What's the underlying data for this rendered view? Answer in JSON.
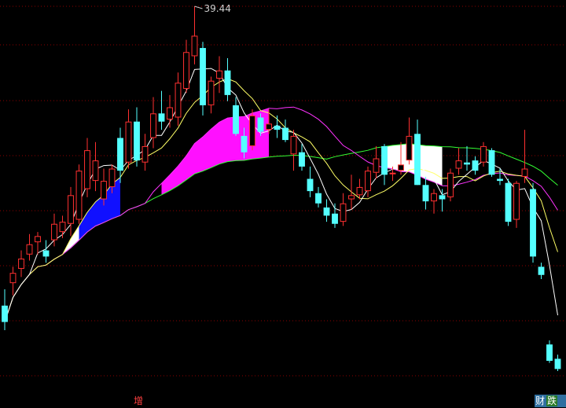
{
  "chart_data": {
    "type": "candlestick",
    "grid": true,
    "max_label": "39.44",
    "markers": [
      "增",
      "财",
      "跌"
    ],
    "colors": {
      "background": "#000000",
      "grid": "#8b0000",
      "up": "#ff3030",
      "down": "#54ffff",
      "ma_white": "#ffffff",
      "ma_yellow": "#ffff66",
      "ma_magenta": "#ff33ff",
      "ma_green": "#33ff33",
      "band_white": "#ffffff",
      "band_blue": "#1010ff",
      "band_magenta": "#ff10ff"
    },
    "candles": [
      [
        24.8,
        25.6,
        23.6,
        24.0
      ],
      [
        25.9,
        26.7,
        25.3,
        26.4
      ],
      [
        26.6,
        27.5,
        26.2,
        27.1
      ],
      [
        27.3,
        28.3,
        27.0,
        27.8
      ],
      [
        27.9,
        28.4,
        27.3,
        28.2
      ],
      [
        27.5,
        28.0,
        26.9,
        27.2
      ],
      [
        28.0,
        29.3,
        27.7,
        28.8
      ],
      [
        28.4,
        29.2,
        28.1,
        28.9
      ],
      [
        28.8,
        30.6,
        28.2,
        30.2
      ],
      [
        29.0,
        31.7,
        28.8,
        31.4
      ],
      [
        30.5,
        33.0,
        30.1,
        32.4
      ],
      [
        30.9,
        32.8,
        30.4,
        31.9
      ],
      [
        30.0,
        31.5,
        29.7,
        30.9
      ],
      [
        30.6,
        31.7,
        30.3,
        31.5
      ],
      [
        33.0,
        33.5,
        30.8,
        31.4
      ],
      [
        31.8,
        34.4,
        31.5,
        33.8
      ],
      [
        33.8,
        34.5,
        31.6,
        31.9
      ],
      [
        31.8,
        33.2,
        31.4,
        32.6
      ],
      [
        33.0,
        35.0,
        32.5,
        34.2
      ],
      [
        34.2,
        35.3,
        33.4,
        33.8
      ],
      [
        33.9,
        35.1,
        33.5,
        34.5
      ],
      [
        34.0,
        36.2,
        33.6,
        35.7
      ],
      [
        35.4,
        37.8,
        35.2,
        37.2
      ],
      [
        37.0,
        39.44,
        36.6,
        38.0
      ],
      [
        37.4,
        37.7,
        34.1,
        34.6
      ],
      [
        34.6,
        36.0,
        34.2,
        35.8
      ],
      [
        35.9,
        37.0,
        35.2,
        36.3
      ],
      [
        36.3,
        36.9,
        34.8,
        35.1
      ],
      [
        34.6,
        35.0,
        33.1,
        33.2
      ],
      [
        33.1,
        33.5,
        32.0,
        32.3
      ],
      [
        32.6,
        34.4,
        32.4,
        34.1
      ],
      [
        34.0,
        34.2,
        33.1,
        33.3
      ],
      [
        33.4,
        34.4,
        33.2,
        33.7
      ],
      [
        33.6,
        34.1,
        33.0,
        33.4
      ],
      [
        33.5,
        33.9,
        32.8,
        32.9
      ],
      [
        32.2,
        33.4,
        31.4,
        33.1
      ],
      [
        32.3,
        32.7,
        31.4,
        31.6
      ],
      [
        31.0,
        31.6,
        30.1,
        30.4
      ],
      [
        30.3,
        30.6,
        29.6,
        29.8
      ],
      [
        29.6,
        30.0,
        28.9,
        29.2
      ],
      [
        29.3,
        29.8,
        28.6,
        28.8
      ],
      [
        28.9,
        30.3,
        28.7,
        29.8
      ],
      [
        30.0,
        31.2,
        29.5,
        30.2
      ],
      [
        30.2,
        31.0,
        30.0,
        30.6
      ],
      [
        30.4,
        31.6,
        30.1,
        31.4
      ],
      [
        31.3,
        32.6,
        31.0,
        32.0
      ],
      [
        32.6,
        32.7,
        30.7,
        31.2
      ],
      [
        31.3,
        31.6,
        30.9,
        31.3
      ],
      [
        31.4,
        32.8,
        31.2,
        31.7
      ],
      [
        31.9,
        34.0,
        31.7,
        33.1
      ],
      [
        33.2,
        33.9,
        30.7,
        30.7
      ],
      [
        30.7,
        31.1,
        29.5,
        29.9
      ],
      [
        29.9,
        30.5,
        29.3,
        30.3
      ],
      [
        30.2,
        30.5,
        29.4,
        30.0
      ],
      [
        30.1,
        31.5,
        29.9,
        31.3
      ],
      [
        31.5,
        32.5,
        31.2,
        31.9
      ],
      [
        31.8,
        32.6,
        31.4,
        31.7
      ],
      [
        31.9,
        32.1,
        31.2,
        31.4
      ],
      [
        31.8,
        32.8,
        31.6,
        32.6
      ],
      [
        32.4,
        32.5,
        31.1,
        31.2
      ],
      [
        31.0,
        31.5,
        30.7,
        30.9
      ],
      [
        30.8,
        31.0,
        28.7,
        28.9
      ],
      [
        29.0,
        30.9,
        28.6,
        30.8
      ],
      [
        31.1,
        33.4,
        30.8,
        31.5
      ],
      [
        30.5,
        30.8,
        26.9,
        27.2
      ],
      [
        26.7,
        26.9,
        26.1,
        26.3
      ],
      [
        22.9,
        23.1,
        22.0,
        22.1
      ],
      [
        22.2,
        22.4,
        21.6,
        21.7
      ]
    ]
  }
}
